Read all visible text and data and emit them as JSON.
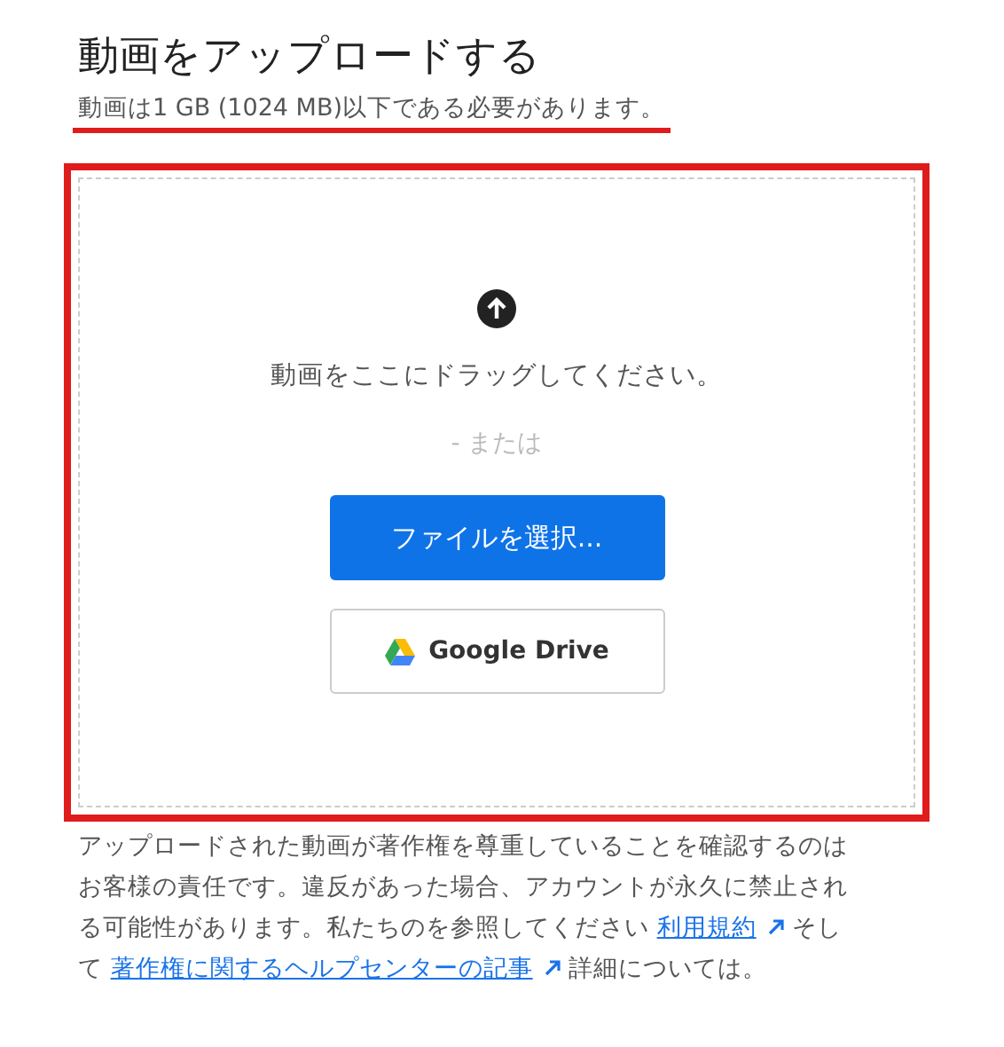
{
  "title": "動画をアップロードする",
  "subtitle": "動画は1 GB (1024 MB)以下である必要があります。",
  "dropzone": {
    "drag_text": "動画をここにドラッグしてください。",
    "or_text": "- または",
    "buttons": [
      {
        "kind": "primary",
        "label": "ファイルを選択..."
      },
      {
        "kind": "drive",
        "label": "Google Drive"
      }
    ]
  },
  "notice": [
    {
      "kind": "text",
      "text": "アップロードされた動画が著作権を尊重していることを確認するのはお客様の責任です。違反があった場合、アカウントが永久に禁止される可能性があります。私たちのを参照してください "
    },
    {
      "kind": "link",
      "text": "利用規約"
    },
    {
      "kind": "text",
      "text": " そして "
    },
    {
      "kind": "link",
      "text": "著作権に関するヘルプセンターの記事"
    },
    {
      "kind": "text",
      "text": " 詳細については。"
    }
  ]
}
